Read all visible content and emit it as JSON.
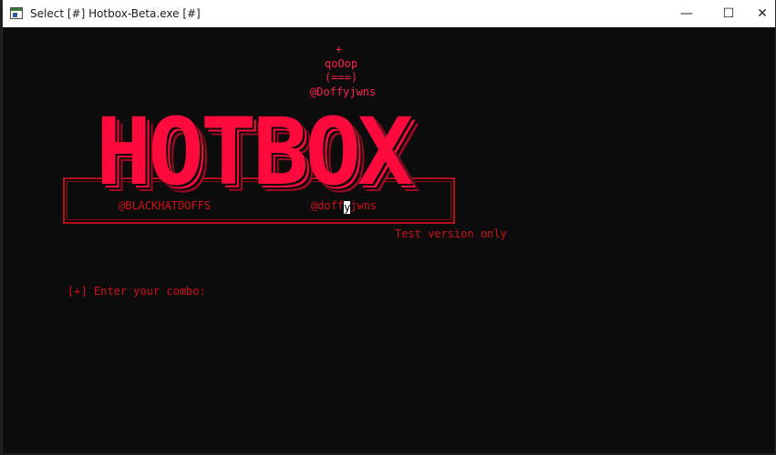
{
  "window": {
    "title": "Select [#] Hotbox-Beta.exe [#]",
    "controls": {
      "minimize": "—",
      "maximize": "☐",
      "close": "✕"
    }
  },
  "console": {
    "art_lines": [
      "+",
      "qoOop",
      "(===)",
      "@Doffyjwns"
    ],
    "logo": "HOTBOX",
    "handle_left": "@BLACKHATDOFFS",
    "handle_right_before_cursor": "@doff",
    "handle_right_cursor_char": "y",
    "handle_right_after_cursor": "jwns",
    "note": "Test version only",
    "prompt": "[+] Enter your combo:"
  },
  "colors": {
    "accent_pink": "#ff1f4f",
    "accent_red": "#d01016",
    "background": "#0c0c0c"
  }
}
